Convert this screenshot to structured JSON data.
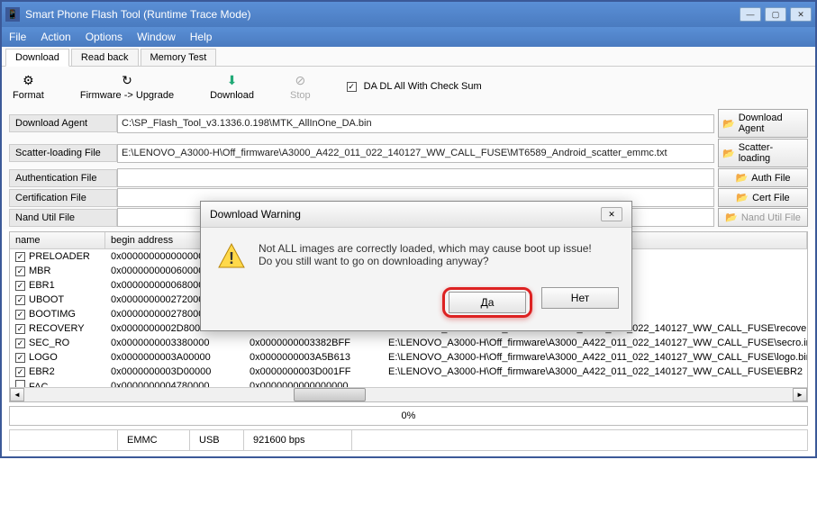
{
  "window": {
    "title": "Smart Phone Flash Tool (Runtime Trace Mode)"
  },
  "menu": {
    "file": "File",
    "action": "Action",
    "options": "Options",
    "window": "Window",
    "help": "Help"
  },
  "tabs": {
    "download": "Download",
    "readback": "Read back",
    "memtest": "Memory Test"
  },
  "toolbar": {
    "format": "Format",
    "firmware": "Firmware -> Upgrade",
    "download": "Download",
    "stop": "Stop",
    "checkbox_label": "DA DL All With Check Sum"
  },
  "files": {
    "da_label": "Download Agent",
    "da_value": "C:\\SP_Flash_Tool_v3.1336.0.198\\MTK_AllInOne_DA.bin",
    "da_btn": "Download Agent",
    "scatter_label": "Scatter-loading File",
    "scatter_value": "E:\\LENOVO_A3000-H\\Off_firmware\\A3000_A422_011_022_140127_WW_CALL_FUSE\\MT6589_Android_scatter_emmc.txt",
    "scatter_btn": "Scatter-loading",
    "auth_label": "Authentication File",
    "auth_value": "",
    "auth_btn": "Auth File",
    "cert_label": "Certification File",
    "cert_value": "",
    "cert_btn": "Cert File",
    "nand_label": "Nand Util File",
    "nand_value": "",
    "nand_btn": "Nand Util File"
  },
  "table": {
    "hdr_name": "name",
    "hdr_begin": "begin address",
    "hdr_end": "end address",
    "hdr_loc": "location",
    "rows": [
      {
        "checked": true,
        "name": "PRELOADER",
        "begin": "0x0000000000000000",
        "end": "",
        "loc": "0127_WW_CALL_FUSE\\preload"
      },
      {
        "checked": true,
        "name": "MBR",
        "begin": "0x0000000000600000",
        "end": "",
        "loc": "0127_WW_CALL_FUSE\\MBR"
      },
      {
        "checked": true,
        "name": "EBR1",
        "begin": "0x0000000000680000",
        "end": "",
        "loc": "0127_WW_CALL_FUSE\\EBR1"
      },
      {
        "checked": true,
        "name": "UBOOT",
        "begin": "0x0000000002720000",
        "end": "",
        "loc": "0127_WW_CALL_FUSE\\lk.bin"
      },
      {
        "checked": true,
        "name": "BOOTIMG",
        "begin": "0x0000000002780000",
        "end": "",
        "loc": "0127_WW_CALL_FUSE\\boot.im"
      },
      {
        "checked": true,
        "name": "RECOVERY",
        "begin": "0x0000000002D80000",
        "end": "0x000000000329BFFF",
        "loc": "E:\\LENOVO_A3000-H\\Off_firmware\\A3000_A422_011_022_140127_WW_CALL_FUSE\\recovery"
      },
      {
        "checked": true,
        "name": "SEC_RO",
        "begin": "0x0000000003380000",
        "end": "0x0000000003382BFF",
        "loc": "E:\\LENOVO_A3000-H\\Off_firmware\\A3000_A422_011_022_140127_WW_CALL_FUSE\\secro.in"
      },
      {
        "checked": true,
        "name": "LOGO",
        "begin": "0x0000000003A00000",
        "end": "0x0000000003A5B613",
        "loc": "E:\\LENOVO_A3000-H\\Off_firmware\\A3000_A422_011_022_140127_WW_CALL_FUSE\\logo.bin"
      },
      {
        "checked": true,
        "name": "EBR2",
        "begin": "0x0000000003D00000",
        "end": "0x0000000003D001FF",
        "loc": "E:\\LENOVO_A3000-H\\Off_firmware\\A3000_A422_011_022_140127_WW_CALL_FUSE\\EBR2"
      },
      {
        "checked": false,
        "name": "FAC",
        "begin": "0x0000000004780000",
        "end": "0x0000000000000000",
        "loc": ""
      }
    ]
  },
  "progress": {
    "text": "0%"
  },
  "status": {
    "emmc": "EMMC",
    "usb": "USB",
    "baud": "921600 bps"
  },
  "dialog": {
    "title": "Download Warning",
    "line1": "Not ALL images are correctly loaded, which may cause boot up issue!",
    "line2": "Do you still want to go on downloading anyway?",
    "yes": "Да",
    "no": "Нет"
  }
}
